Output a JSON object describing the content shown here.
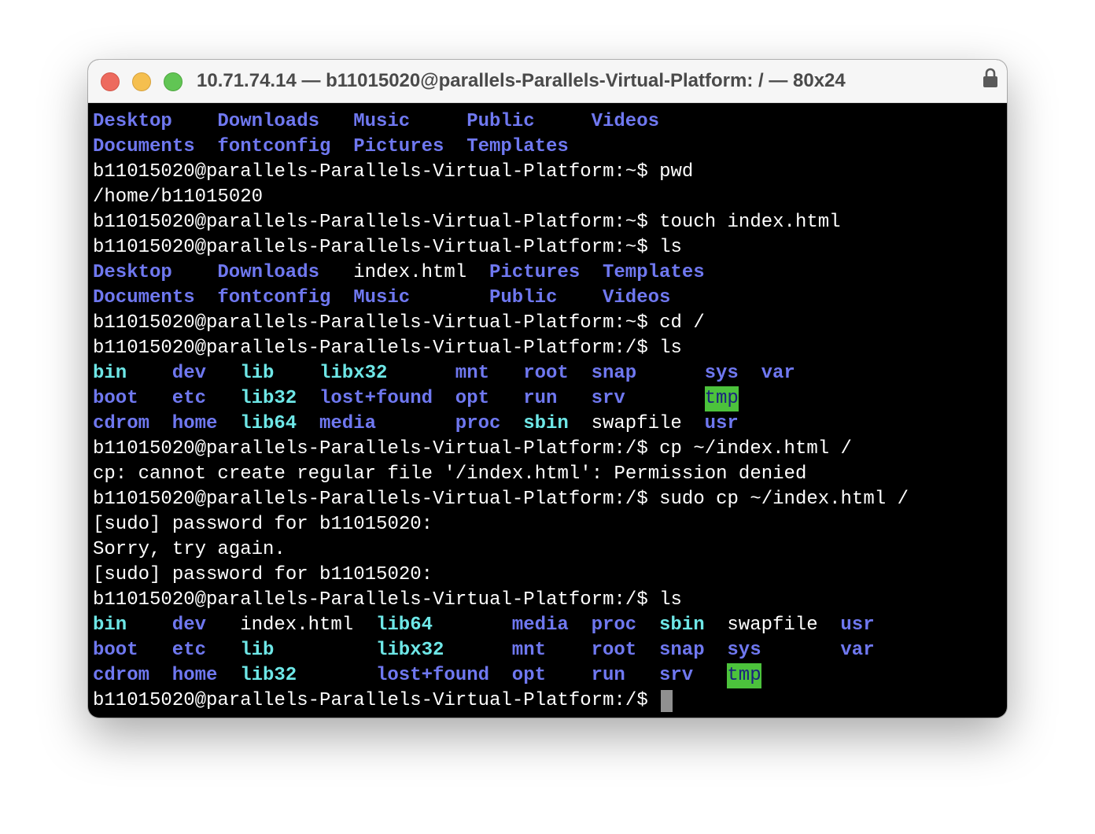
{
  "window": {
    "title": "10.71.74.14 — b11015020@parallels-Parallels-Virtual-Platform: / — 80x24",
    "lock_icon": "lock-icon"
  },
  "terminal": {
    "line1": [
      "Desktop",
      "Downloads",
      "Music",
      "Public",
      "Videos"
    ],
    "line2": [
      "Documents",
      "fontconfig",
      "Pictures",
      "Templates"
    ],
    "line3": "b11015020@parallels-Parallels-Virtual-Platform:~$ pwd",
    "line4": "/home/b11015020",
    "line5": "b11015020@parallels-Parallels-Virtual-Platform:~$ touch index.html",
    "line6": "b11015020@parallels-Parallels-Virtual-Platform:~$ ls",
    "line7": [
      "Desktop",
      "Downloads",
      "index.html",
      "Pictures",
      "Templates"
    ],
    "line8": [
      "Documents",
      "fontconfig",
      "Music",
      "Public",
      "Videos"
    ],
    "line9": "b11015020@parallels-Parallels-Virtual-Platform:~$ cd /",
    "line10": "b11015020@parallels-Parallels-Virtual-Platform:/$ ls",
    "line11": [
      "bin",
      "dev",
      "lib",
      "libx32",
      "mnt",
      "root",
      "snap",
      "sys",
      "var"
    ],
    "line12": [
      "boot",
      "etc",
      "lib32",
      "lost+found",
      "opt",
      "run",
      "srv",
      "tmp"
    ],
    "line13": [
      "cdrom",
      "home",
      "lib64",
      "media",
      "proc",
      "sbin",
      "swapfile",
      "usr"
    ],
    "line14": "b11015020@parallels-Parallels-Virtual-Platform:/$ cp ~/index.html /",
    "line15": "cp: cannot create regular file '/index.html': Permission denied",
    "line16": "b11015020@parallels-Parallels-Virtual-Platform:/$ sudo cp ~/index.html /",
    "line17": "[sudo] password for b11015020:",
    "line18": "Sorry, try again.",
    "line19": "[sudo] password for b11015020:",
    "line20": "b11015020@parallels-Parallels-Virtual-Platform:/$ ls",
    "line21": [
      "bin",
      "dev",
      "index.html",
      "lib64",
      "media",
      "proc",
      "sbin",
      "swapfile",
      "usr"
    ],
    "line22": [
      "boot",
      "etc",
      "lib",
      "libx32",
      "mnt",
      "root",
      "snap",
      "sys",
      "var"
    ],
    "line23": [
      "cdrom",
      "home",
      "lib32",
      "lost+found",
      "opt",
      "run",
      "srv",
      "tmp"
    ],
    "line24": "b11015020@parallels-Parallels-Virtual-Platform:/$ "
  },
  "colors": {
    "directory": "#6f78f0",
    "symlink": "#6ee7e7",
    "sticky_dir_bg": "#4cc23c",
    "background": "#000000",
    "text": "#ffffff"
  }
}
